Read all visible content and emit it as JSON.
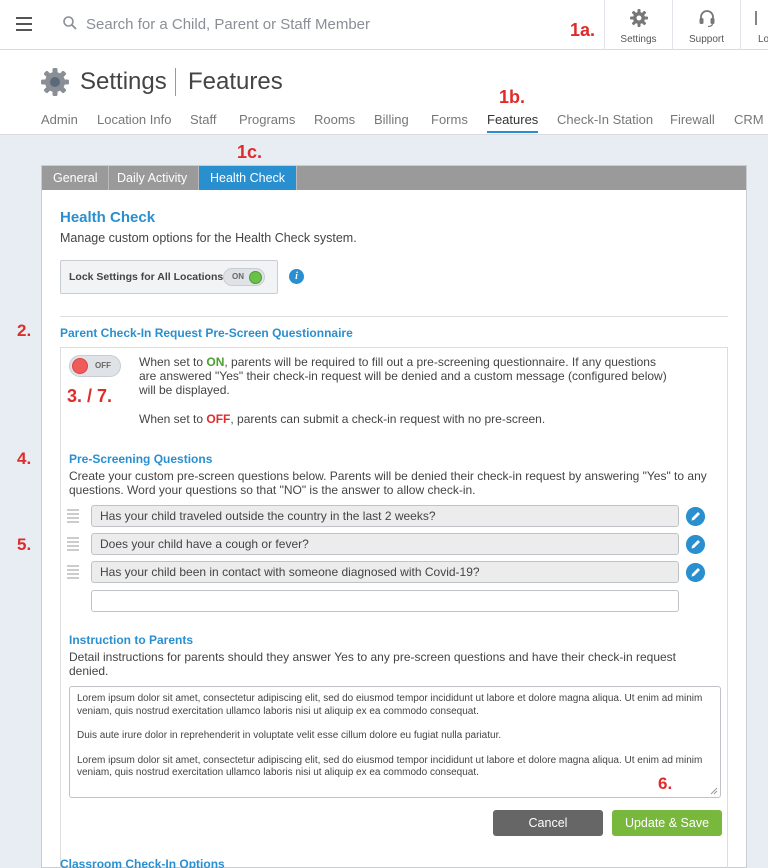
{
  "search": {
    "placeholder": "Search for a Child, Parent or Staff Member"
  },
  "top_actions": [
    {
      "label": "Settings",
      "icon": "gear-icon"
    },
    {
      "label": "Support",
      "icon": "headset-icon"
    },
    {
      "label": "Lo",
      "icon": "logout-icon"
    }
  ],
  "annotations": {
    "a1a": "1a.",
    "a1b": "1b.",
    "a1c": "1c.",
    "a2": "2.",
    "a3_7": "3. / 7.",
    "a4": "4.",
    "a5": "5.",
    "a6": "6."
  },
  "header": {
    "title": "Settings",
    "subtitle": "Features"
  },
  "nav_tabs": [
    "Admin",
    "Location Info",
    "Staff",
    "Programs",
    "Rooms",
    "Billing",
    "Forms",
    "Features",
    "Check-In Station",
    "Firewall",
    "CRM"
  ],
  "active_nav_tab": "Features",
  "subtabs": [
    "General",
    "Daily Activity",
    "Health Check"
  ],
  "active_subtab": "Health Check",
  "health_check": {
    "title": "Health Check",
    "description": "Manage custom options for the Health Check system.",
    "lock_label": "Lock Settings for All Locations",
    "lock_toggle": "ON"
  },
  "prescreen": {
    "title": "Parent Check-In Request Pre-Screen Questionnaire",
    "toggle": "OFF",
    "on_prefix": "When set to ",
    "on_word": "ON",
    "on_rest": ", parents will be required to fill out a pre-screening questionnaire. If any questions are answered \"Yes\" their check-in request will be denied and a custom message (configured below) will be displayed.",
    "off_prefix": "When set to ",
    "off_word": "OFF",
    "off_rest": ", parents can submit a check-in request with no pre-screen."
  },
  "questions": {
    "title": "Pre-Screening Questions",
    "description": "Create your custom pre-screen questions below. Parents will be denied their check-in request by answering \"Yes\" to any questions. Word your questions so that \"NO\" is the answer to allow check-in.",
    "items": [
      "Has your child traveled outside the country in the last 2 weeks?",
      "Does your child have a cough or fever?",
      "Has your child been in contact with someone diagnosed with Covid-19?"
    ],
    "new_value": ""
  },
  "instructions": {
    "title": "Instruction to Parents",
    "description": "Detail instructions for parents should they answer Yes to any pre-screen questions and have their check-in request denied.",
    "paragraphs": [
      "Lorem ipsum dolor sit amet, consectetur adipiscing elit, sed do eiusmod tempor incididunt ut labore et dolore magna aliqua. Ut enim ad minim veniam, quis nostrud exercitation ullamco laboris nisi ut aliquip ex ea commodo consequat.",
      "Duis aute irure dolor in reprehenderit in voluptate velit esse cillum dolore eu fugiat nulla pariatur.",
      "Lorem ipsum dolor sit amet, consectetur adipiscing elit, sed do eiusmod tempor incididunt ut labore et dolore magna aliqua. Ut enim ad minim veniam, quis nostrud exercitation ullamco laboris nisi ut aliquip ex ea commodo consequat."
    ]
  },
  "buttons": {
    "cancel": "Cancel",
    "save": "Update & Save"
  },
  "next_section_title": "Classroom Check-In Options",
  "colors": {
    "accent": "#2a8fcf",
    "on": "#4aa030",
    "off": "#e02b2b",
    "annotation": "#e02b2b",
    "save": "#78b83d"
  }
}
